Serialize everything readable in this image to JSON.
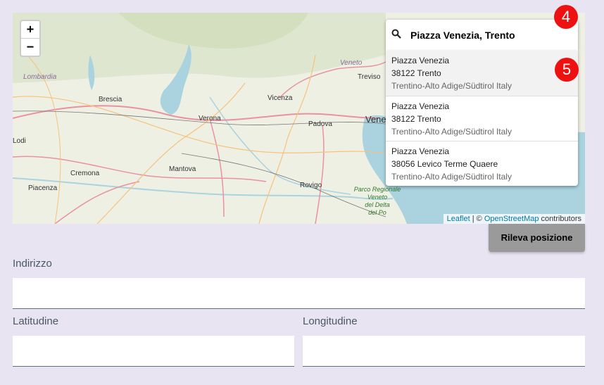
{
  "map": {
    "zoom_in": "+",
    "zoom_out": "−",
    "cities": [
      "Brescia",
      "Verona",
      "Vicenza",
      "Padova",
      "Treviso",
      "Venezia",
      "Lodi",
      "Cremona",
      "Mantova",
      "Rovigo",
      "Piacenza"
    ],
    "regions": [
      "Lombardia",
      "Veneto"
    ],
    "park": [
      "Parco Regionale",
      "Veneto",
      "del Delta",
      "del Po"
    ],
    "attribution": {
      "leaflet": "Leaflet",
      "sep": " | © ",
      "osm": "OpenStreetMap",
      "suffix": " contributors"
    }
  },
  "search": {
    "icon": "search-icon",
    "query": "Piazza Venezia, Trento",
    "results": [
      {
        "line1": "Piazza Venezia",
        "line2": "38122 Trento",
        "line3": "Trentino-Alto Adige/Südtirol Italy"
      },
      {
        "line1": "Piazza Venezia",
        "line2": "38122 Trento",
        "line3": "Trentino-Alto Adige/Südtirol Italy"
      },
      {
        "line1": "Piazza Venezia",
        "line2": "38056 Levico Terme Quaere",
        "line3": "Trentino-Alto Adige/Südtirol Italy"
      }
    ]
  },
  "badges": {
    "step4": "4",
    "step5": "5"
  },
  "form": {
    "detect_button": "Rileva posizione",
    "address_label": "Indirizzo",
    "latitude_label": "Latitudine",
    "longitude_label": "Longitudine",
    "address_value": "",
    "latitude_value": "",
    "longitude_value": ""
  },
  "colors": {
    "accent_badge": "#ee1111",
    "button": "#9a9a9a",
    "background": "#e8e4f2"
  }
}
